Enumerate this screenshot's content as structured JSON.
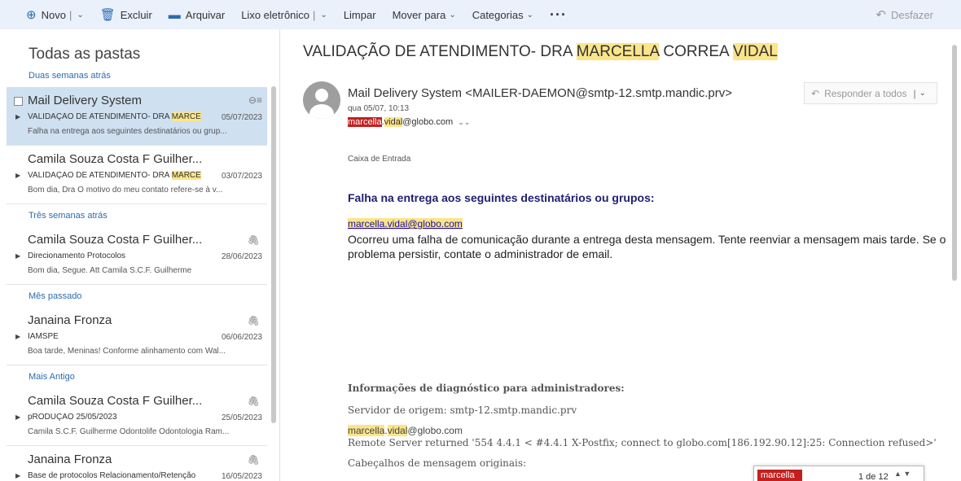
{
  "toolbar": {
    "new_label": "Novo",
    "delete_label": "Excluir",
    "archive_label": "Arquivar",
    "junk_label": "Lixo eletrônico",
    "sweep_label": "Limpar",
    "move_label": "Mover para",
    "categories_label": "Categorias",
    "undo_label": "Desfazer"
  },
  "folder": {
    "title": "Todas as pastas"
  },
  "groups": {
    "g1": "Duas semanas atrás",
    "g2": "Três semanas atrás",
    "g3": "Mês passado",
    "g4": "Mais Antigo"
  },
  "messages": [
    {
      "from": "Mail Delivery System",
      "subject_pre": "VALIDAÇÃO DE ATENDIMENTO- DRA ",
      "subject_hl": "MARCE",
      "date": "05/07/2023",
      "preview": "Falha na entrega aos seguintes destinatários ou grup..."
    },
    {
      "from": "Camila Souza Costa F Guilher...",
      "subject_pre": "VALIDAÇÃO DE ATENDIMENTO- DRA ",
      "subject_hl": "MARCE",
      "date": "03/07/2023",
      "preview": "Bom dia, Dra O motivo do meu contato refere-se à v..."
    },
    {
      "from": "Camila Souza Costa F Guilher...",
      "subject_pre": "Direcionamento Protocolos",
      "subject_hl": "",
      "date": "28/06/2023",
      "preview": "Bom dia, Segue. Att Camila S.C.F. Guilherme"
    },
    {
      "from": "Janaina Fronza",
      "subject_pre": "IAMSPE",
      "subject_hl": "",
      "date": "06/06/2023",
      "preview": "Boa tarde, Meninas! Conforme alinhamento com Wal..."
    },
    {
      "from": "Camila Souza Costa F Guilher...",
      "subject_pre": "pRODUÇÃO 25/05/2023",
      "subject_hl": "",
      "date": "25/05/2023",
      "preview": "Camila S.C.F. Guilherme Odontolife Odontologia Ram..."
    },
    {
      "from": "Janaina Fronza",
      "subject_pre": "Base de protocolos Relacionamento/Retenção",
      "subject_hl": "",
      "date": "16/05/2023",
      "preview": ""
    }
  ],
  "reader": {
    "subject_a": "VALIDAÇÃO DE ATENDIMENTO- DRA ",
    "subject_b": "MARCELLA",
    "subject_c": " CORREA ",
    "subject_d": "VIDAL",
    "sender": "Mail Delivery System <MAILER-DAEMON@smtp-12.smtp.mandic.prv>",
    "sent": "qua 05/07, 10:13",
    "to_a": "marcella",
    "to_b": ".",
    "to_c": "vidal",
    "to_d": "@globo.com",
    "reply_all": "Responder a todos",
    "folder_label": "Caixa de Entrada",
    "fail_title": "Falha na entrega aos seguintes destinatários ou grupos:",
    "fail_addr": "marcella.vidal@globo.com",
    "fail_body": "Ocorreu uma falha de comunicação durante a entrega desta mensagem. Tente reenviar a mensagem mais tarde. Se o problema persistir, contate o administrador de email.",
    "diag_title": "Informações de diagnóstico para administradores:",
    "diag_server": "Servidor de origem: smtp-12.smtp.mandic.prv",
    "diag_addr_a": "marcella",
    "diag_addr_b": ".",
    "diag_addr_c": "vidal",
    "diag_addr_d": "@globo.com",
    "diag_remote": "Remote Server returned '554 4.4.1 < #4.4.1 X-Postfix; connect to globo.com[186.192.90.12]:25: Connection refused>'",
    "diag_headers": "Cabeçalhos de mensagem originais:"
  },
  "findbar": {
    "term": "marcella",
    "count": "1 de 12"
  },
  "colors": {
    "accent": "#2b6cb0",
    "highlight": "#fbe58a",
    "selected": "#cfe0f1",
    "find": "#c41f1f"
  }
}
